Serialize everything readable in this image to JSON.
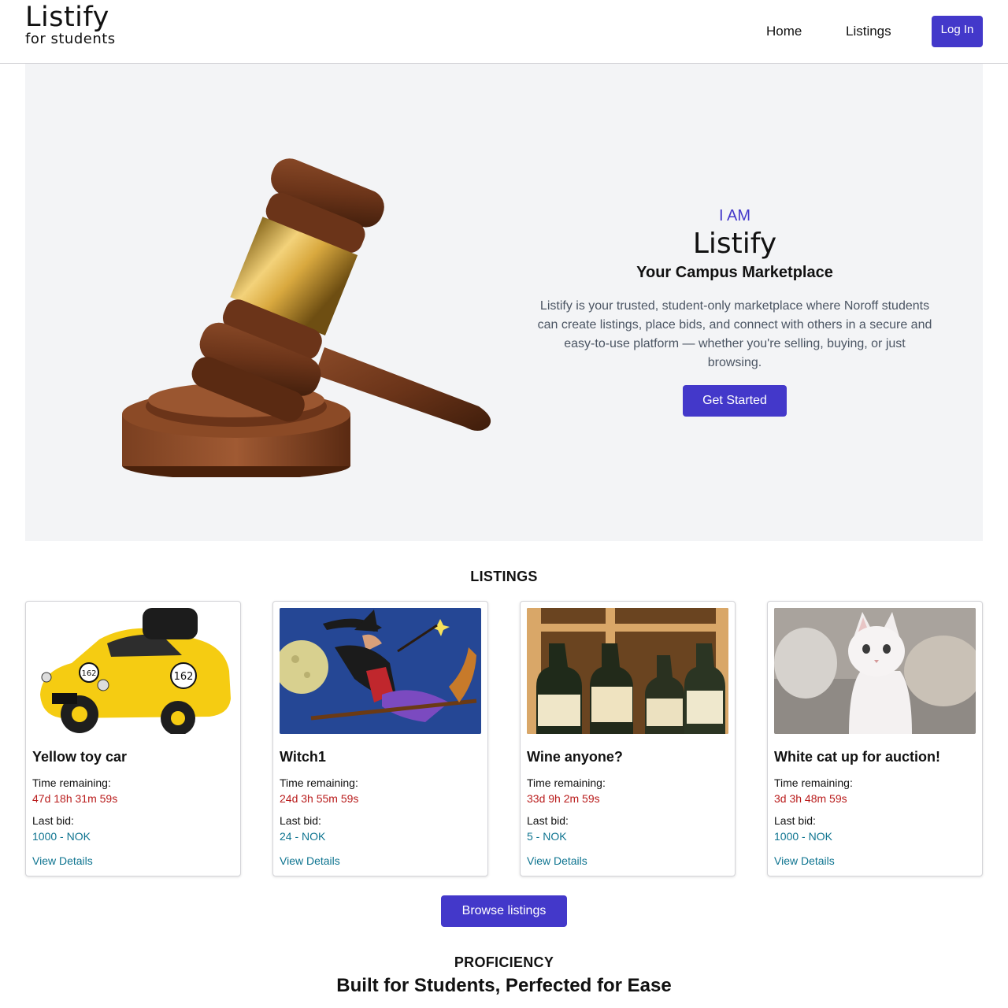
{
  "header": {
    "brand_name": "Listify",
    "brand_sub": "for students",
    "nav": {
      "home": "Home",
      "listings": "Listings"
    },
    "login_label": "Log In"
  },
  "hero": {
    "eyebrow": "I AM",
    "title": "Listify",
    "tagline": "Your Campus Marketplace",
    "description": "Listify is your trusted, student-only marketplace where Noroff students can create listings, place bids, and connect with others in a secure and easy-to-use platform — whether you're selling, buying, or just browsing.",
    "cta_label": "Get Started"
  },
  "listings": {
    "section_label": "LISTINGS",
    "time_label": "Time remaining:",
    "bid_label": "Last bid:",
    "view_label": "View Details",
    "items": [
      {
        "title": "Yellow toy car",
        "time": "47d 18h 31m 59s",
        "bid": "1000 - NOK"
      },
      {
        "title": "Witch1",
        "time": "24d 3h 55m 59s",
        "bid": "24 - NOK"
      },
      {
        "title": "Wine anyone?",
        "time": "33d 9h 2m 59s",
        "bid": "5 - NOK"
      },
      {
        "title": "White cat up for auction!",
        "time": "3d 3h 48m 59s",
        "bid": "1000 - NOK"
      }
    ],
    "browse_label": "Browse listings"
  },
  "proficiency": {
    "label": "PROFICIENCY",
    "heading": "Built for Students, Perfected for Ease"
  },
  "colors": {
    "accent": "#4338ca",
    "time_text": "#b91c1c",
    "bid_text": "#0e7490",
    "hero_bg": "#f3f4f6"
  }
}
